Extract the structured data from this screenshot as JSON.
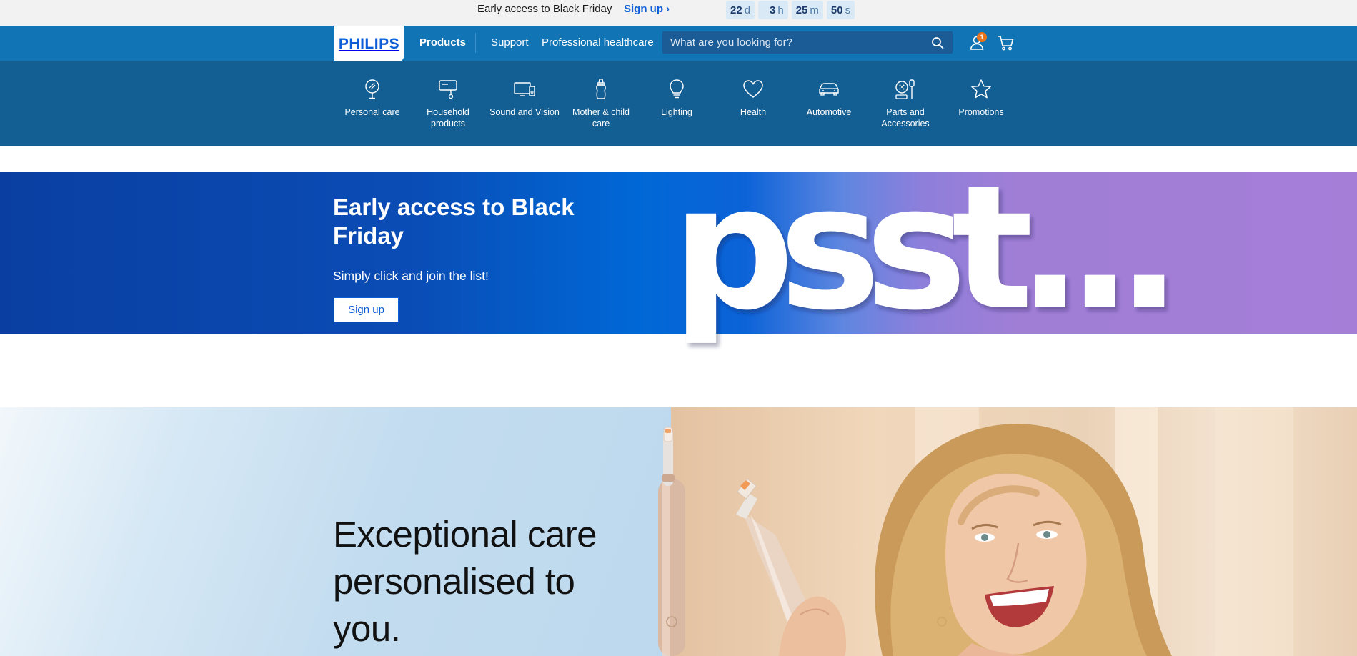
{
  "promo": {
    "text": "Early access to Black Friday",
    "link": "Sign up ›",
    "countdown": [
      {
        "num": "22",
        "unit": "d"
      },
      {
        "num": "3",
        "unit": "h"
      },
      {
        "num": "25",
        "unit": "m"
      },
      {
        "num": "50",
        "unit": "s"
      }
    ]
  },
  "nav": {
    "logo": "PHILIPS",
    "products": "Products",
    "support": "Support",
    "professional": "Professional healthcare",
    "search_placeholder": "What are you looking for?",
    "user_badge": "1"
  },
  "categories": [
    {
      "label": "Personal care",
      "icon": "mirror-icon"
    },
    {
      "label": "Household products",
      "icon": "mixer-icon"
    },
    {
      "label": "Sound and Vision",
      "icon": "tv-speaker-icon"
    },
    {
      "label": "Mother & child care",
      "icon": "baby-bottle-icon"
    },
    {
      "label": "Lighting",
      "icon": "lightbulb-icon"
    },
    {
      "label": "Health",
      "icon": "heart-icon"
    },
    {
      "label": "Automotive",
      "icon": "car-icon"
    },
    {
      "label": "Parts and Accessories",
      "icon": "parts-icon"
    },
    {
      "label": "Promotions",
      "icon": "star-icon"
    }
  ],
  "banner": {
    "title": "Early access to Black Friday",
    "subtitle": "Simply click and join the list!",
    "button": "Sign up",
    "art_text": "psst..."
  },
  "hero": {
    "title": "Exceptional care personalised to you."
  },
  "colors": {
    "brand_blue": "#0b5ed7",
    "nav_blue": "#1175b5",
    "category_blue": "#135e93",
    "badge_orange": "#e8731b"
  }
}
